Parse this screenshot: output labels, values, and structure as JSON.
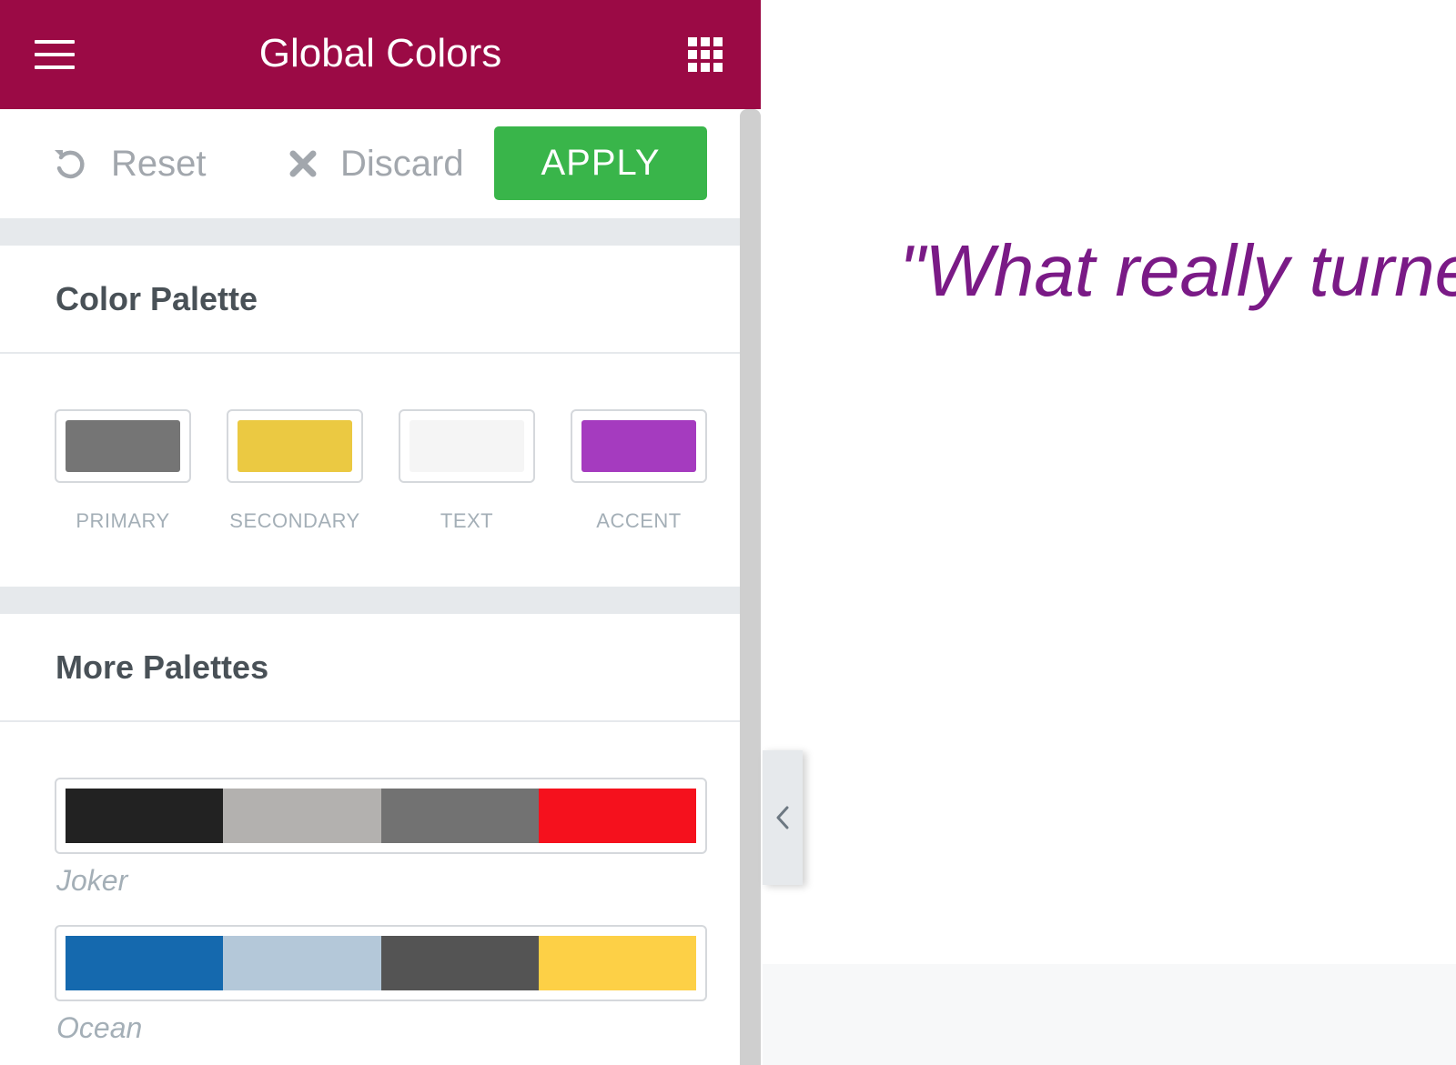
{
  "header": {
    "title": "Global Colors",
    "menu_icon": "hamburger-icon",
    "apps_icon": "grid-icon"
  },
  "toolbar": {
    "reset_label": "Reset",
    "discard_label": "Discard",
    "apply_label": "APPLY",
    "reset_icon": "undo-icon",
    "discard_icon": "close-icon"
  },
  "color_palette": {
    "title": "Color Palette",
    "swatches": [
      {
        "label": "PRIMARY",
        "color": "#757575"
      },
      {
        "label": "SECONDARY",
        "color": "#ebc942"
      },
      {
        "label": "TEXT",
        "color": "#f5f5f5"
      },
      {
        "label": "ACCENT",
        "color": "#a53bbf"
      }
    ]
  },
  "more_palettes": {
    "title": "More Palettes",
    "palettes": [
      {
        "name": "Joker",
        "colors": [
          "#222222",
          "#b3b1af",
          "#727272",
          "#f5111d"
        ]
      },
      {
        "name": "Ocean",
        "colors": [
          "#1569ae",
          "#b4c8d9",
          "#545454",
          "#fdd046"
        ]
      }
    ]
  },
  "preview": {
    "quote_text": "\"What really turned"
  },
  "colors": {
    "header_bg": "#9b0a45",
    "apply_bg": "#39b54a",
    "quote_color": "#7a1a86"
  }
}
